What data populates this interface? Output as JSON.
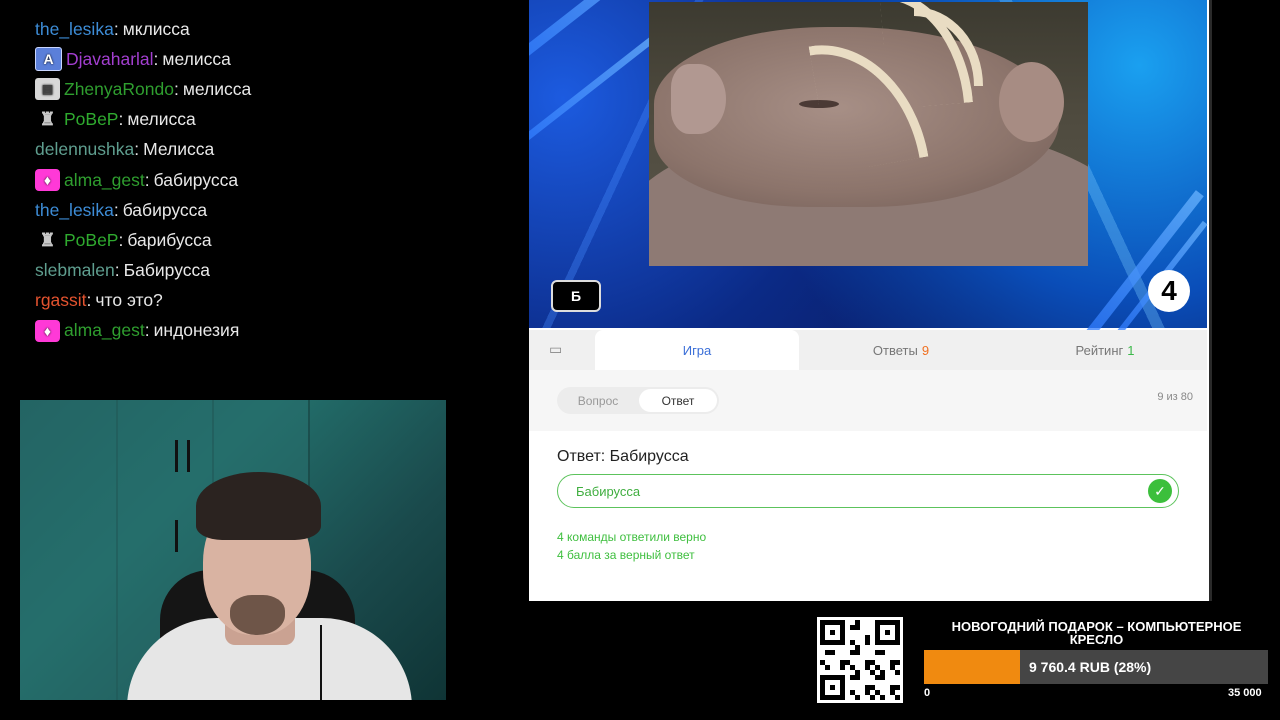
{
  "chat": {
    "messages": [
      {
        "badge": "",
        "user": "the_lesika",
        "user_color": "#3d8cd6",
        "text": "мклисса"
      },
      {
        "badge": "letter-a",
        "user": "Djavaharlal",
        "user_color": "#a33fd0",
        "text": "мелисса"
      },
      {
        "badge": "stack-icon",
        "user": "ZhenyaRondo",
        "user_color": "#2f9e2f",
        "text": "мелисса"
      },
      {
        "badge": "robot-icon",
        "user": "PoBeP",
        "user_color": "#2faa2f",
        "text": "мелисса"
      },
      {
        "badge": "",
        "user": "delennushka",
        "user_color": "#5f9e8f",
        "text": "Мелисса"
      },
      {
        "badge": "gem-icon",
        "user": "alma_gest",
        "user_color": "#2f9e2f",
        "text": "бабирусса"
      },
      {
        "badge": "",
        "user": "the_lesika",
        "user_color": "#3d8cd6",
        "text": "бабирусса"
      },
      {
        "badge": "robot-icon",
        "user": "PoBeP",
        "user_color": "#2faa2f",
        "text": "барибусса"
      },
      {
        "badge": "",
        "user": "slebmalen",
        "user_color": "#5f9e8f",
        "text": "Бабирусса"
      },
      {
        "badge": "",
        "user": "rgassit",
        "user_color": "#e4532f",
        "text": "что это?"
      },
      {
        "badge": "gem-icon",
        "user": "alma_gest",
        "user_color": "#2f9e2f",
        "text": "индонезия"
      }
    ]
  },
  "game": {
    "letter": "Б",
    "round_number": "4",
    "tabs": {
      "game": "Игра",
      "answers": "Ответы",
      "answers_count": "9",
      "rating": "Рейтинг",
      "rating_count": "1"
    },
    "segment": {
      "question": "Вопрос",
      "answer": "Ответ"
    },
    "counter": "9 из 80",
    "answer_title": "Ответ: Бабирусса",
    "answer_value": "Бабирусса",
    "teams_correct": "4 команды ответили верно",
    "points": "4 балла за верный ответ"
  },
  "donation": {
    "title": "НОВОГОДНИЙ ПОДАРОК – КОМПЬЮТЕРНОЕ КРЕСЛО",
    "amount_text": "9 760.4 RUB (28%)",
    "progress_fraction": 0.28,
    "min_label": "0",
    "max_label": "35 000",
    "bar_color": "#f08a10"
  }
}
